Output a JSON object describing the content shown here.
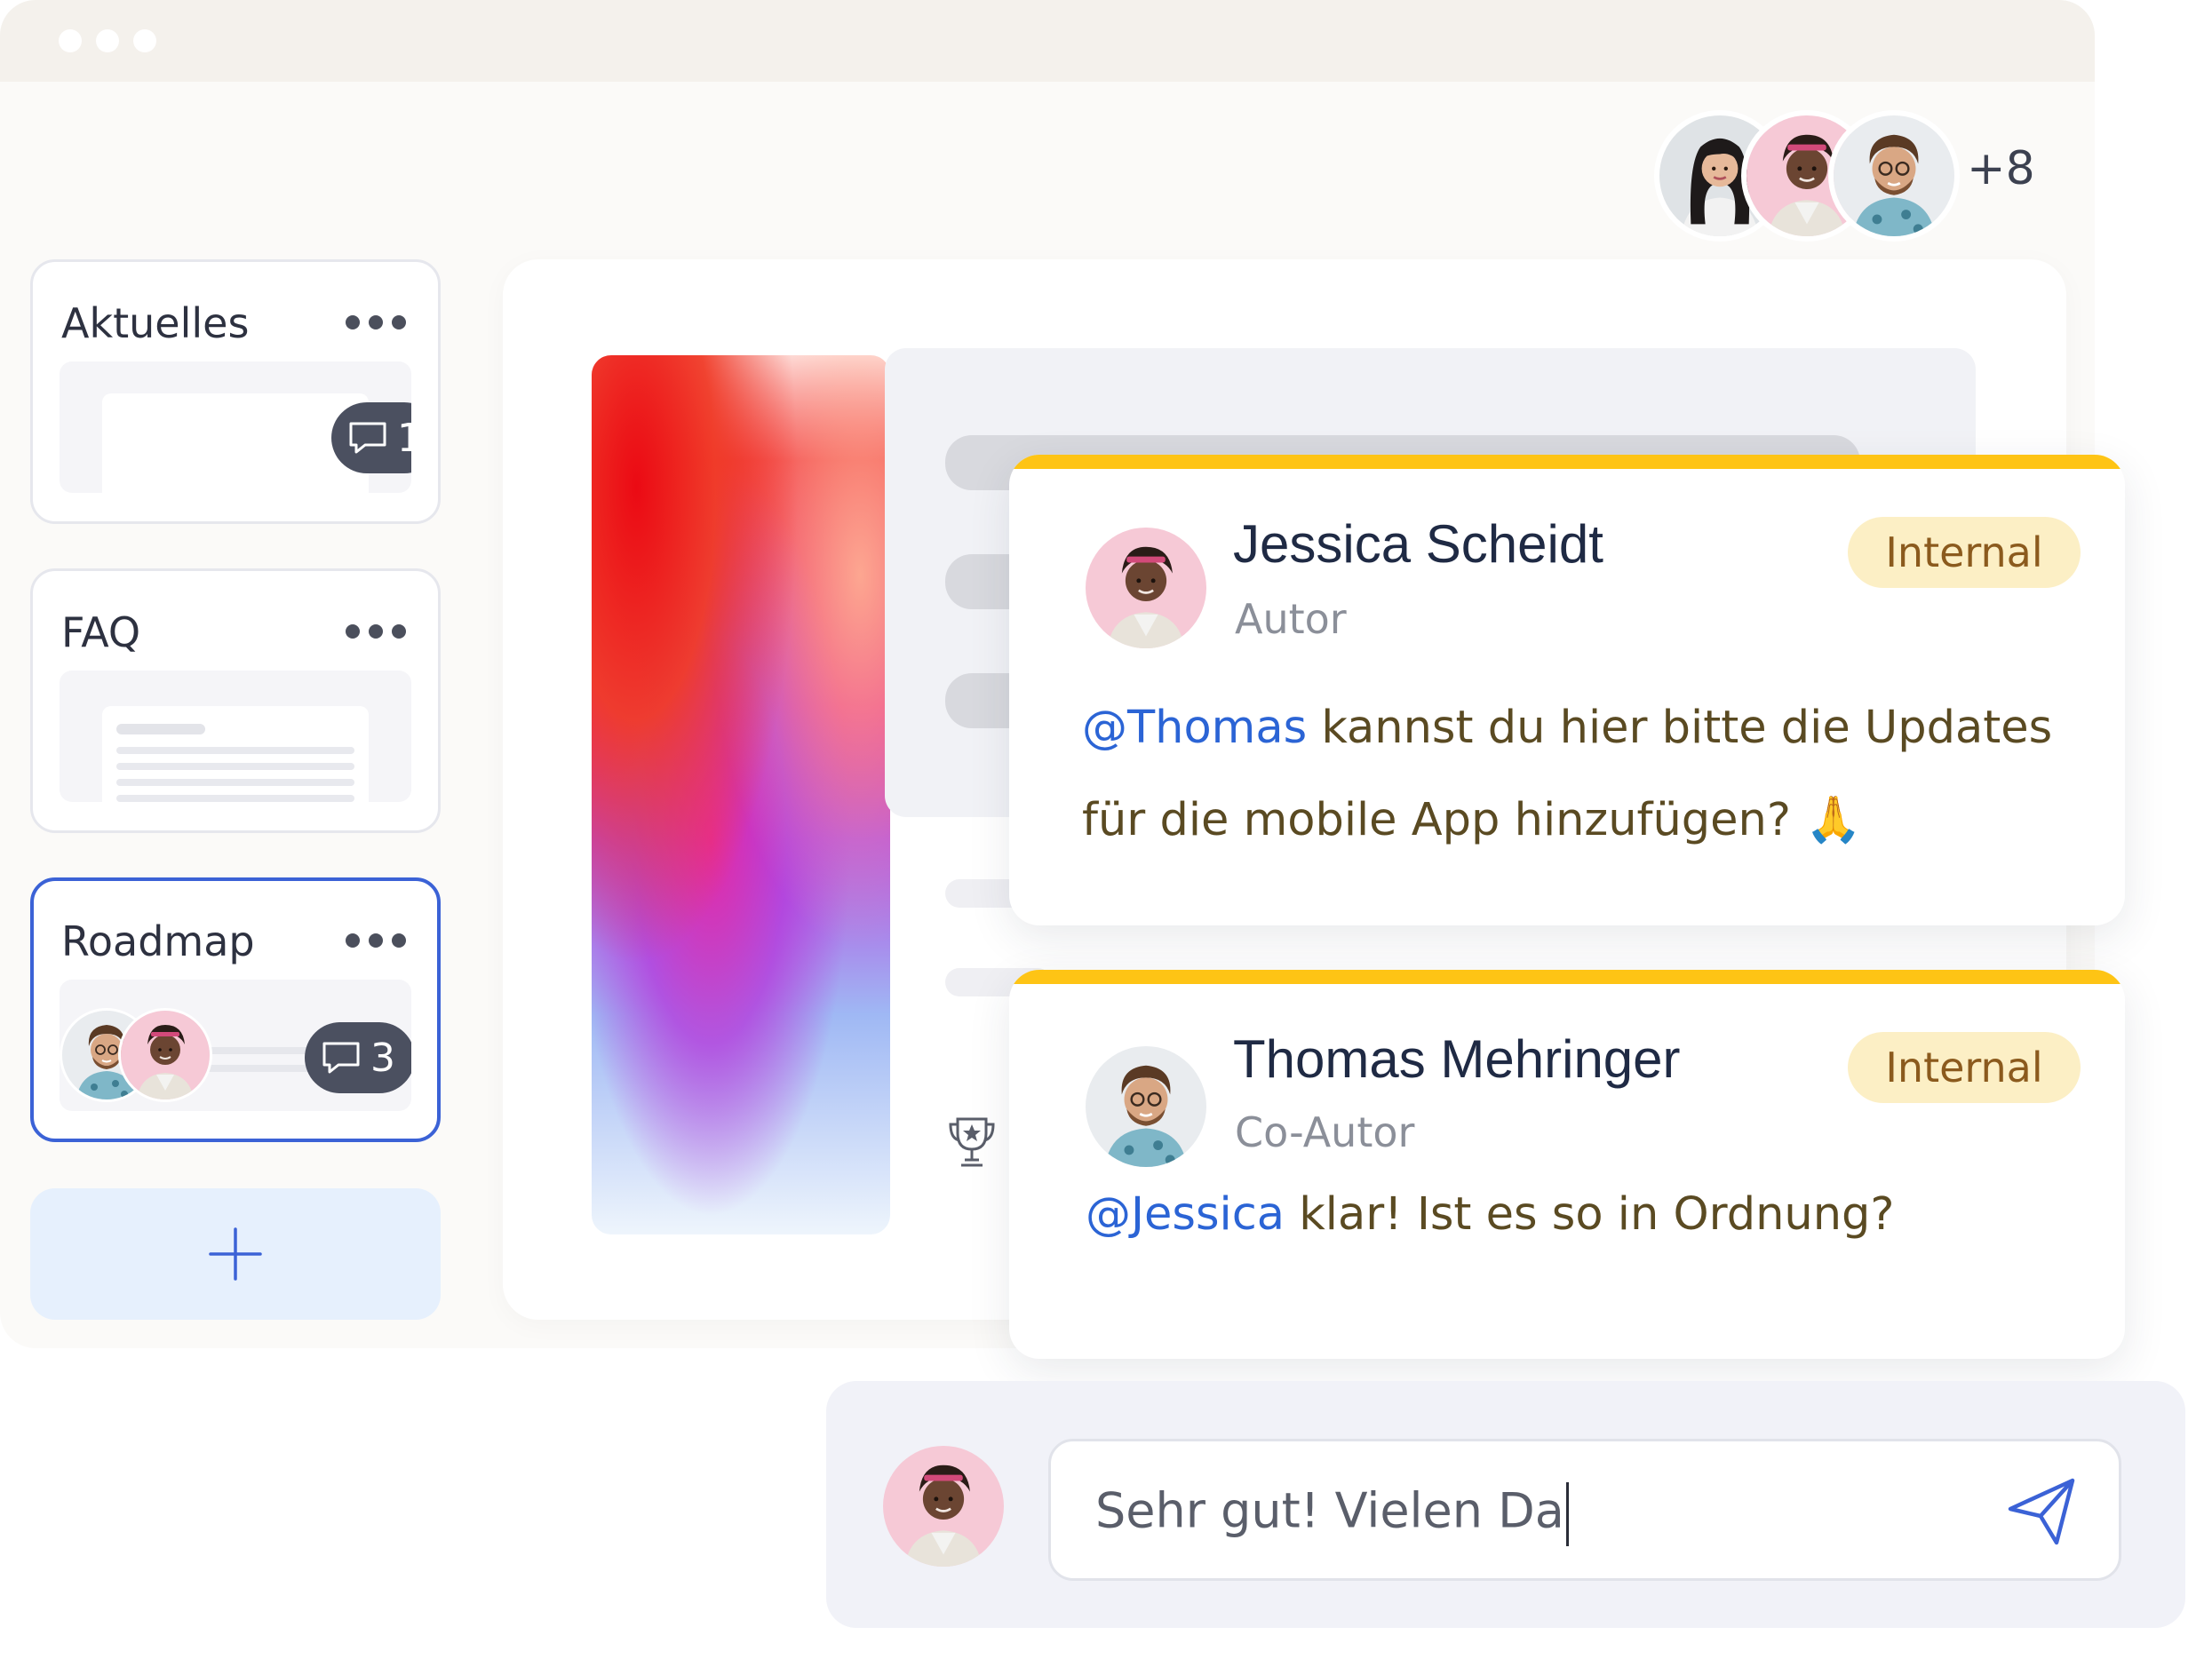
{
  "collaborators": {
    "avatars": [
      "woman-long-hair-avatar",
      "jessica-avatar",
      "thomas-avatar"
    ],
    "more_count": "+8"
  },
  "sidebar": {
    "cards": [
      {
        "title": "Aktuelles",
        "comment_count": "1"
      },
      {
        "title": "FAQ"
      },
      {
        "title": "Roadmap",
        "comment_count": "3"
      }
    ],
    "add_icon": "plus-icon"
  },
  "comments": [
    {
      "author": "Jessica Scheidt",
      "role": "Autor",
      "tag": "Internal",
      "mention": "@Thomas",
      "text_line1": " kannst du hier bitte die Updates",
      "text_line2": "für die mobile App hinzufügen? 🙏"
    },
    {
      "author": "Thomas Mehringer",
      "role": "Co-Autor",
      "tag": "Internal",
      "mention": "@Jessica",
      "text_line1": " klar! Ist es so in Ordnung?"
    }
  ],
  "reply": {
    "value": "Sehr gut! Vielen Da",
    "send_icon": "send-icon"
  },
  "colors": {
    "accent_blue": "#3b62d6",
    "mention_blue": "#2b64d5",
    "comment_bar_yellow": "#fec415",
    "tag_bg": "#fcefc5",
    "tag_text": "#8b5a1d"
  }
}
